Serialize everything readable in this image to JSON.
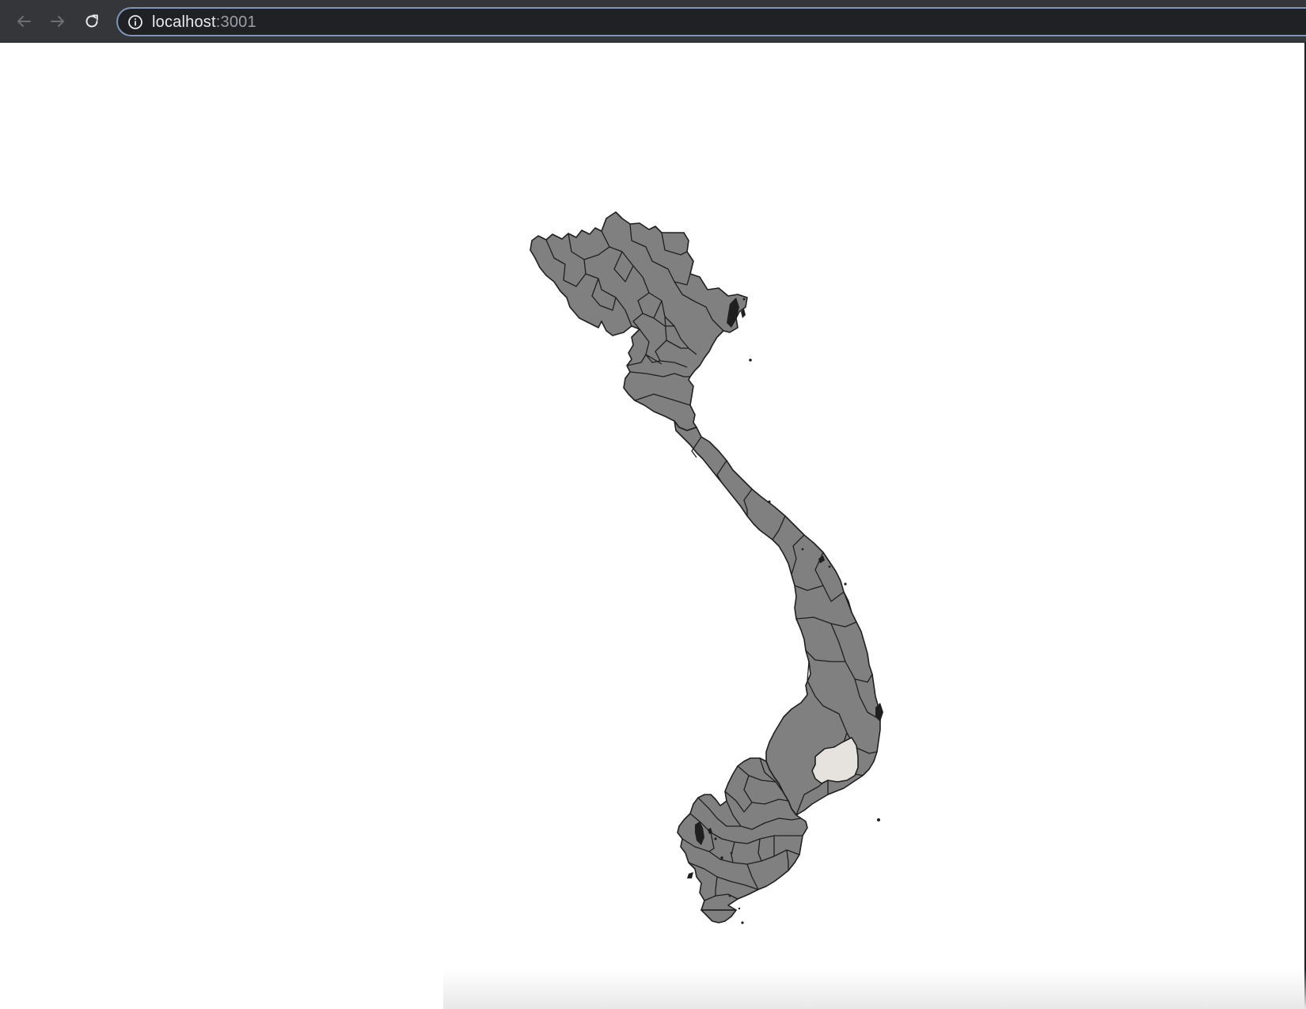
{
  "browser": {
    "url_host": "localhost",
    "url_port": ":3001",
    "back_icon": "back-arrow-icon",
    "forward_icon": "forward-arrow-icon",
    "reload_icon": "reload-icon",
    "site_info_icon": "info-icon"
  },
  "map": {
    "country": "Vietnam",
    "fill_color": "#808080",
    "border_color": "#1f1f1f",
    "highlight_color": "#e6e3df",
    "highlighted_region_count": 1
  }
}
